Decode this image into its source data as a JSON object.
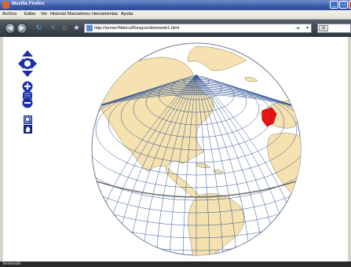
{
  "window": {
    "title": "Mozilla Firefox",
    "controls": {
      "minimize": "_",
      "maximize": "□",
      "close": "✕"
    }
  },
  "menu": [
    "Archivo",
    "Editar",
    "Ver",
    "Historial",
    "Marcadores",
    "Herramientas",
    "Ayuda"
  ],
  "toolbar": {
    "back": "◀",
    "forward": "▶",
    "url": "http://server/htdocs/Riesgos/detveweb1.html",
    "go": "➜",
    "dropdown": "▾",
    "search_engine": "W"
  },
  "icons": {
    "reload": "reload-icon",
    "stop": "stop-icon",
    "home": "home-icon",
    "bookmark": "star-icon",
    "pan": "pan-arrows-icon",
    "zoom_in": "plus-icon",
    "zoom_out": "minus-icon",
    "zoom_box": "zoom-box-icon",
    "hand": "hand-icon"
  },
  "colors": {
    "land": "#f5e2b0",
    "ocean": "#ffffff",
    "graticule": "#1a3f8c",
    "highlight": "#ee1111",
    "map_control": "#1d2fa8"
  },
  "status": {
    "text": "Terminado"
  }
}
